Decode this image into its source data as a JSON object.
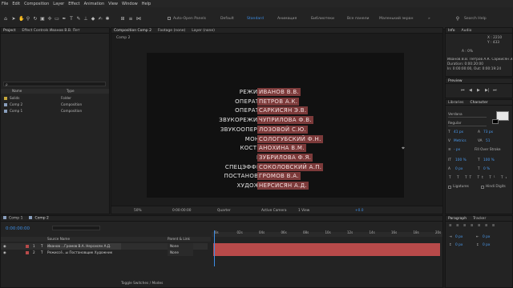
{
  "menu": [
    "File",
    "Edit",
    "Composition",
    "Layer",
    "Effect",
    "Animation",
    "View",
    "Window",
    "Help"
  ],
  "toolbar": {
    "auto_open_panels": "Auto-Open Panels",
    "workspaces": [
      "Default",
      "Standard",
      "Анимация",
      "Библиотеки",
      "Все панели",
      "Маленький экран"
    ],
    "active_workspace_index": 1,
    "search_placeholder": "Search Help"
  },
  "project": {
    "tab": "Project",
    "effect_controls_tab": "Effect Controls Иванов В.В. Пет",
    "search_placeholder": "ρ",
    "columns": {
      "name": "Name",
      "type": "Type"
    },
    "items": [
      {
        "name": "Solids",
        "type": "Folder",
        "color": "#c5a73b"
      },
      {
        "name": "Comp 2",
        "type": "Composition",
        "color": "#8a9fbd"
      },
      {
        "name": "Comp 1",
        "type": "Composition",
        "color": "#8a9fbd"
      }
    ]
  },
  "viewer": {
    "comp_tab": "Composition Comp 2",
    "footage_tab": "Footage (none)",
    "layer_tab": "Layer (none)",
    "breadcrumb": "Comp 2",
    "zoom": "50%",
    "timecode": "0:00:00:00",
    "resolution": "Quarter",
    "camera": "Active Camera",
    "view": "1 View",
    "exposure": "+0.0"
  },
  "credits": [
    {
      "role": "РЕЖИССЁР",
      "name": "ИВАНОВ В.В."
    },
    {
      "role": "ОПЕРАТОР 1",
      "name": "ПЕТРОВ А.К."
    },
    {
      "role": "ОПЕРАТОР 2",
      "name": "САРКИСЯН Э.В."
    },
    {
      "role": "ЗВУКОРЕЖИССЁР",
      "name": "ЧУПРИЛОВА Ф.В."
    },
    {
      "role": "ЗВУКООПЕРАТОР",
      "name": "ЛОЗОВОЙ С.Ю."
    },
    {
      "role": "МОНТАЖ",
      "name": "СОЛОГУБСКИЙ Ф.Н."
    },
    {
      "role": "КОСТЮМЫ",
      "name": "АНОХИНА В.М."
    },
    {
      "role": "ГРИМ",
      "name": "ЗУБРИЛОВА Ф.Я."
    },
    {
      "role": "СПЕЦЭФФЕКТЫ",
      "name": "СОКОЛОВСКИЙ А.П."
    },
    {
      "role": "ПОСТАНОВЩИК",
      "name": "ГРОМОВ В.А."
    },
    {
      "role": "ХУДОЖНИК",
      "name": "НЕРСИСЯН А.Д."
    }
  ],
  "info": {
    "tab": "Info",
    "audio_tab": "Audio",
    "x": "X : 2210",
    "y": "Y : 433",
    "alpha": "A : 0%",
    "layer_name": "Иванов В.В. Петров А.К. Саркисян Э.В.",
    "duration": "Duration: 0:00:20:00",
    "in_out": "In: 0:00:00:00, Out: 0:00:19:24"
  },
  "preview": {
    "tab": "Preview"
  },
  "character": {
    "libraries_tab": "Libraries",
    "character_tab": "Character",
    "font": "Verdana",
    "style": "Regular",
    "font_size": "41 px",
    "leading": "73 px",
    "kerning": "Metrics",
    "tracking": "51",
    "stroke_width": "- px",
    "stroke_type": "Fill Over Stroke",
    "vscale": "100 %",
    "hscale": "100 %",
    "baseline": "0 px",
    "tsume": "0 %",
    "ligatures": "Ligatures",
    "hindi": "Hindi Digits"
  },
  "paragraph": {
    "tab": "Paragraph",
    "tracker_tab": "Tracker",
    "indent_left": "0 px",
    "indent_right": "0 px",
    "space_before": "0 px",
    "space_after": "0 px"
  },
  "timeline": {
    "tabs": [
      "Comp 1",
      "Comp 2"
    ],
    "active_tab": 1,
    "timecode": "0:00:00:00",
    "columns": {
      "source_name": "Source Name",
      "parent": "Parent & Link"
    },
    "layers": [
      {
        "num": "1",
        "name": "Иванов ...Громов В.А. Нерсисян А.Д.",
        "parent": "None",
        "color": "#b84a4a"
      },
      {
        "num": "2",
        "name": "Режиссё...ы Постановщик Художник",
        "parent": "None",
        "color": "#b84a4a"
      }
    ],
    "ruler_labels": [
      "0s",
      "02s",
      "04s",
      "06s",
      "08s",
      "10s",
      "12s",
      "14s",
      "16s",
      "18s",
      "20s"
    ],
    "toggle_label": "Toggle Switches / Modes"
  },
  "colors": {
    "accent": "#3d8ee6",
    "layer_label": "#b84a4a",
    "credit_highlight": "#7c3a3a"
  }
}
